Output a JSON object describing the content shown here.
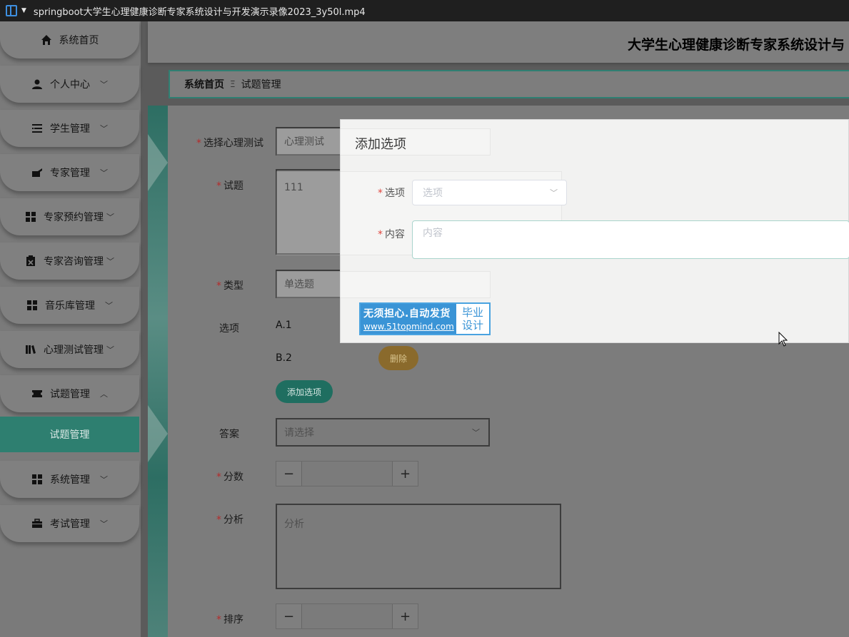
{
  "window": {
    "title": "springboot大学生心理健康诊断专家系统设计与开发演示录像2023_3y50l.mp4"
  },
  "sidebar": {
    "items": [
      {
        "label": "系统首页",
        "icon": "home-icon",
        "has_chevron": false
      },
      {
        "label": "个人中心",
        "icon": "user-icon",
        "has_chevron": true
      },
      {
        "label": "学生管理",
        "icon": "list-icon",
        "has_chevron": true
      },
      {
        "label": "专家管理",
        "icon": "briefcase-icon",
        "has_chevron": true
      },
      {
        "label": "专家预约管理",
        "icon": "grid-icon",
        "has_chevron": true
      },
      {
        "label": "专家咨询管理",
        "icon": "clipboard-icon",
        "has_chevron": true
      },
      {
        "label": "音乐库管理",
        "icon": "grid-icon",
        "has_chevron": true
      },
      {
        "label": "心理测试管理",
        "icon": "book-icon",
        "has_chevron": true
      },
      {
        "label": "试题管理",
        "icon": "ticket-icon",
        "has_chevron": true,
        "expanded": true
      },
      {
        "label": "系统管理",
        "icon": "grid-icon",
        "has_chevron": true
      },
      {
        "label": "考试管理",
        "icon": "toolbox-icon",
        "has_chevron": true
      }
    ],
    "sub_item": "试题管理"
  },
  "header": {
    "title": "大学生心理健康诊断专家系统设计与"
  },
  "breadcrumb": {
    "home": "系统首页",
    "separator": "Ξ",
    "current": "试题管理"
  },
  "form": {
    "test_label": "选择心理测试",
    "test_value": "心理测试",
    "question_label": "试题",
    "question_value": "111",
    "type_label": "类型",
    "type_value": "单选题",
    "options_label": "选项",
    "options": [
      "A.1",
      "B.2"
    ],
    "delete_label": "删除",
    "add_option_label": "添加选项",
    "answer_label": "答案",
    "answer_placeholder": "请选择",
    "score_label": "分数",
    "analysis_label": "分析",
    "analysis_placeholder": "分析",
    "order_label": "排序",
    "minus": "−",
    "plus": "+"
  },
  "modal": {
    "title": "添加选项",
    "option_label": "选项",
    "option_placeholder": "选项",
    "content_label": "内容",
    "content_placeholder": "内容"
  },
  "watermark": {
    "line1": "无须担心.自动发货",
    "line2": "www.51topmind.com",
    "right_line1": "毕业",
    "right_line2": "设计"
  },
  "colors": {
    "accent": "#2e7f70",
    "delete": "#c89a3c",
    "required": "#e0473f",
    "modal_bg": "#f2f2f1"
  }
}
